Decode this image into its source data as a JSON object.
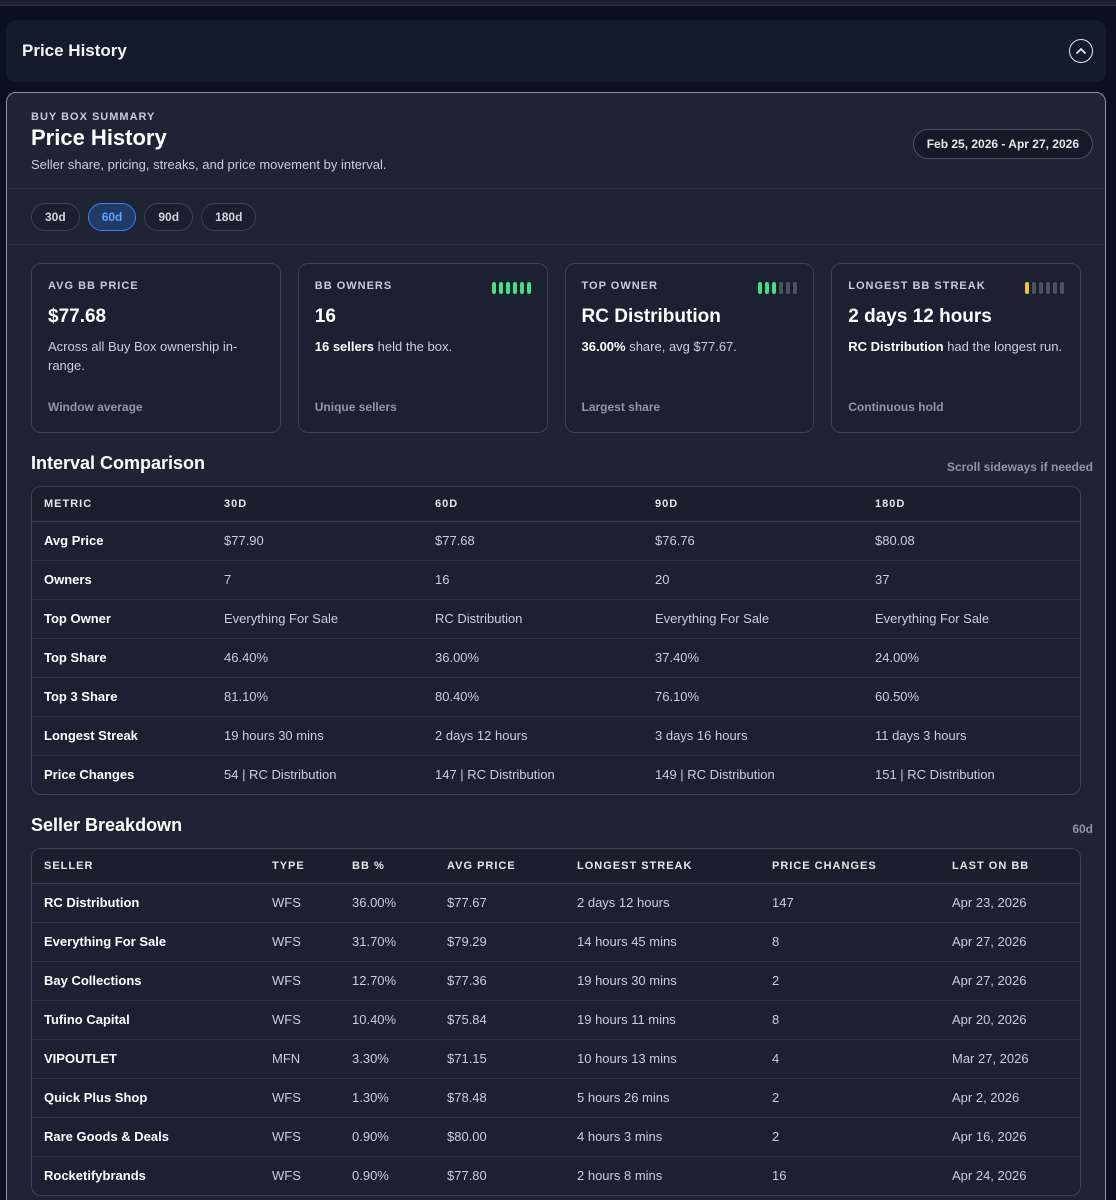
{
  "header": {
    "title": "Price History"
  },
  "panel": {
    "eyebrow": "BUY BOX SUMMARY",
    "title": "Price History",
    "subtitle": "Seller share, pricing, streaks, and price movement by interval.",
    "date_range": "Feb 25, 2026 - Apr 27, 2026"
  },
  "ranges": [
    "30d",
    "60d",
    "90d",
    "180d"
  ],
  "active_range": "60d",
  "cards": {
    "avg": {
      "label": "AVG BB PRICE",
      "value": "$77.68",
      "desc": "Across all Buy Box ownership in-range.",
      "foot": "Window average"
    },
    "owners": {
      "label": "BB OWNERS",
      "value": "16",
      "desc_bold": "16 sellers",
      "desc_rest": " held the box.",
      "foot": "Unique sellers"
    },
    "top": {
      "label": "TOP OWNER",
      "value": "RC Distribution",
      "desc_bold": "36.00%",
      "desc_rest": " share, avg $77.67.",
      "foot": "Largest share"
    },
    "streak": {
      "label": "LONGEST BB STREAK",
      "value": "2 days 12 hours",
      "desc_bold": "RC Distribution",
      "desc_rest": " had the longest run.",
      "foot": "Continuous hold"
    }
  },
  "interval": {
    "title": "Interval Comparison",
    "note": "Scroll sideways if needed",
    "headers": [
      "METRIC",
      "30D",
      "60D",
      "90D",
      "180D"
    ],
    "rows": [
      [
        "Avg Price",
        "$77.90",
        "$77.68",
        "$76.76",
        "$80.08"
      ],
      [
        "Owners",
        "7",
        "16",
        "20",
        "37"
      ],
      [
        "Top Owner",
        "Everything For Sale",
        "RC Distribution",
        "Everything For Sale",
        "Everything For Sale"
      ],
      [
        "Top Share",
        "46.40%",
        "36.00%",
        "37.40%",
        "24.00%"
      ],
      [
        "Top 3 Share",
        "81.10%",
        "80.40%",
        "76.10%",
        "60.50%"
      ],
      [
        "Longest Streak",
        "19 hours 30 mins",
        "2 days 12 hours",
        "3 days 16 hours",
        "11 days 3 hours"
      ],
      [
        "Price Changes",
        "54 | RC Distribution",
        "147 | RC Distribution",
        "149 | RC Distribution",
        "151 | RC Distribution"
      ]
    ]
  },
  "sellers": {
    "title": "Seller Breakdown",
    "note": "60d",
    "headers": [
      "SELLER",
      "TYPE",
      "BB %",
      "AVG PRICE",
      "LONGEST STREAK",
      "PRICE CHANGES",
      "LAST ON BB"
    ],
    "rows": [
      [
        "RC Distribution",
        "WFS",
        "36.00%",
        "$77.67",
        "2 days 12 hours",
        "147",
        "Apr 23, 2026"
      ],
      [
        "Everything For Sale",
        "WFS",
        "31.70%",
        "$79.29",
        "14 hours 45 mins",
        "8",
        "Apr 27, 2026"
      ],
      [
        "Bay Collections",
        "WFS",
        "12.70%",
        "$77.36",
        "19 hours 30 mins",
        "2",
        "Apr 27, 2026"
      ],
      [
        "Tufino Capital",
        "WFS",
        "10.40%",
        "$75.84",
        "19 hours 11 mins",
        "8",
        "Apr 20, 2026"
      ],
      [
        "VIPOUTLET",
        "MFN",
        "3.30%",
        "$71.15",
        "10 hours 13 mins",
        "4",
        "Mar 27, 2026"
      ],
      [
        "Quick Plus Shop",
        "WFS",
        "1.30%",
        "$78.48",
        "5 hours 26 mins",
        "2",
        "Apr 2, 2026"
      ],
      [
        "Rare Goods & Deals",
        "WFS",
        "0.90%",
        "$80.00",
        "4 hours 3 mins",
        "2",
        "Apr 16, 2026"
      ],
      [
        "Rocketifybrands",
        "WFS",
        "0.90%",
        "$77.80",
        "2 hours 8 mins",
        "16",
        "Apr 24, 2026"
      ]
    ]
  },
  "colors": {
    "accent": "#3b82f6",
    "green": "#4ade80",
    "yellow": "#fbbf24"
  }
}
